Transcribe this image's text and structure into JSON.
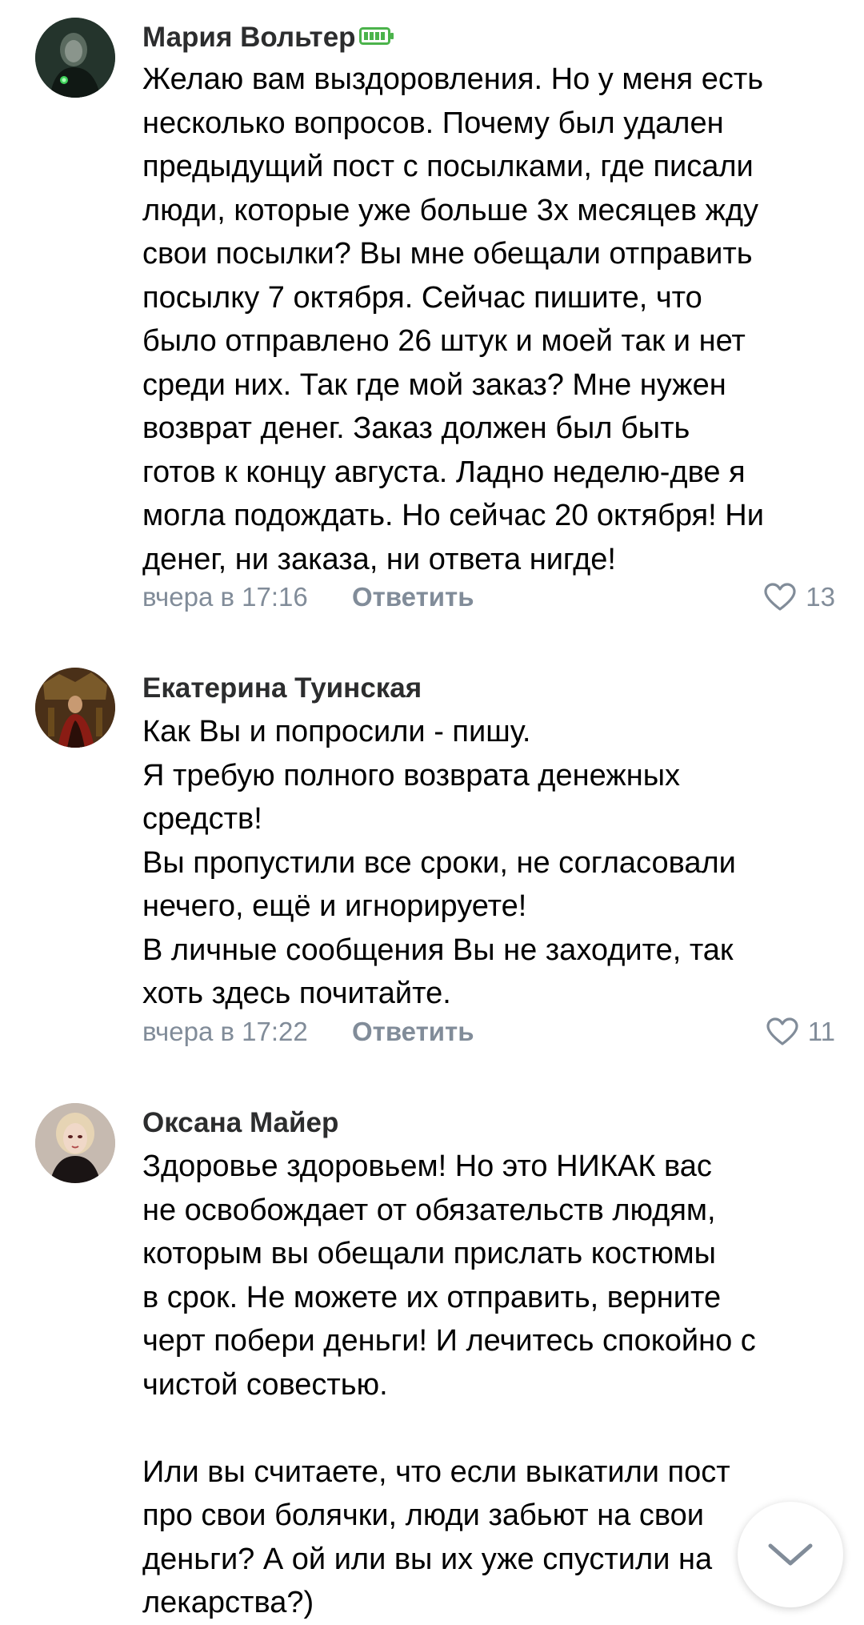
{
  "comments": [
    {
      "author": "Мария Вольтер",
      "author_badge_icon": "battery-icon",
      "lines": [
        "Желаю вам выздоровления. Но у меня есть",
        "несколько вопросов. Почему был удален",
        "предыдущий пост с посылками, где писали",
        "люди, которые уже больше 3х месяцев жду",
        "свои посылки? Вы мне обещали отправить",
        "посылку 7 октября. Сейчас пишите, что",
        "было отправлено 26 штук и моей так и нет",
        "среди них. Так где мой заказ? Мне нужен",
        "возврат денег. Заказ должен был быть",
        "готов к концу августа. Ладно неделю-две я",
        "могла подождать. Но сейчас 20 октября! Ни",
        "денег, ни заказа, ни ответа нигде!"
      ],
      "time": "вчера в 17:16",
      "reply_label": "Ответить",
      "likes": "13"
    },
    {
      "author": "Екатерина Туинская",
      "lines": [
        "Как Вы и попросили - пишу.",
        "Я требую полного возврата денежных",
        "средств!",
        "Вы пропустили все сроки, не согласовали",
        "нечего, ещё и игнорируете!",
        "В личные сообщения Вы не заходите, так",
        "хоть здесь почитайте."
      ],
      "time": "вчера в 17:22",
      "reply_label": "Ответить",
      "likes": "11"
    },
    {
      "author": "Оксана Майер",
      "lines": [
        "Здоровье здоровьем! Но это НИКАК вас",
        "не освобождает от обязательств людям,",
        "которым вы обещали прислать костюмы",
        "в срок. Не можете их отправить, верните",
        "черт побери деньги! И лечитесь спокойно с",
        "чистой совестью.",
        "",
        "Или вы считаете, что если выкатили пост",
        "про свои болячки, люди забьют на свои",
        "деньги? А ой или вы их уже спустили на",
        "лекарства?)"
      ]
    }
  ],
  "colors": {
    "name": "#2c2d2e",
    "meta": "#818c99",
    "battery": "#4bb34b"
  },
  "icons": {
    "like": "heart-outline-icon",
    "scroll": "chevron-down-icon"
  }
}
